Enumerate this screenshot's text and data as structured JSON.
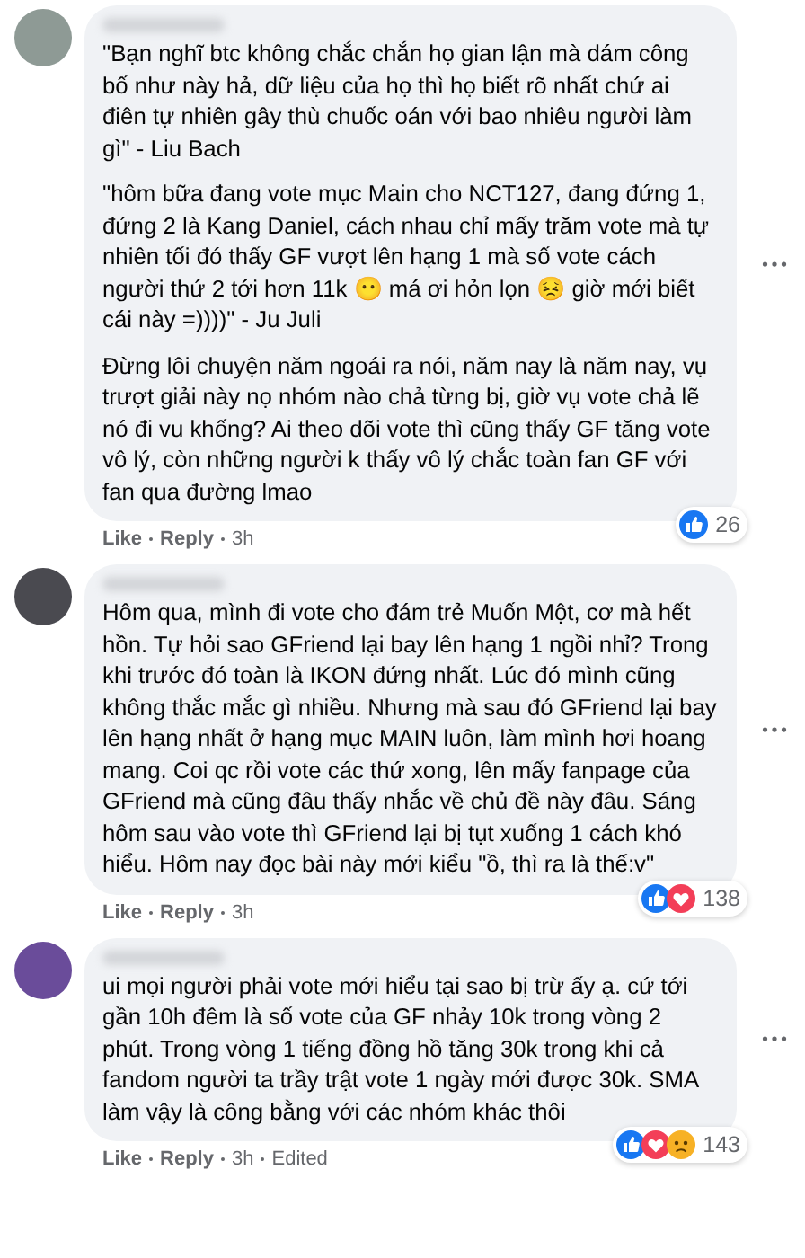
{
  "comments": [
    {
      "paragraphs": [
        "\"Bạn nghĩ btc không chắc chắn họ gian lận mà dám công bố như này hả, dữ liệu của họ thì họ biết rõ nhất chứ ai điên tự nhiên gây thù chuốc oán với bao nhiêu người làm gì\" - Liu Bach",
        "\"hôm bữa đang vote mục Main cho NCT127, đang đứng 1, đứng 2 là Kang Daniel, cách nhau chỉ mấy trăm vote mà tự nhiên tối đó thấy GF vượt lên hạng 1 mà số vote cách người thứ 2 tới hơn 11k 😶 má ơi hỏn lọn 😣 giờ mới biết cái này =))))\" - Ju Juli",
        "Đừng lôi chuyện năm ngoái ra nói, năm nay là năm nay, vụ trượt giải này nọ nhóm nào chả từng bị, giờ vụ vote chả lẽ nó đi vu khống? Ai theo dõi vote thì cũng thấy GF tăng vote vô lý, còn những người k thấy vô lý chắc toàn fan GF với fan qua đường lmao"
      ],
      "actions": [
        "Like",
        "Reply"
      ],
      "meta": [
        "3h"
      ],
      "reactions": [
        {
          "kind": "like"
        }
      ],
      "reaction_count": "26"
    },
    {
      "paragraphs": [
        "Hôm qua, mình đi vote cho đám trẻ Muốn Một, cơ mà hết hồn. Tự hỏi sao GFriend lại bay lên hạng 1 ngồi nhỉ? Trong khi trước đó toàn là IKON đứng nhất. Lúc đó mình cũng không thắc mắc gì nhiều. Nhưng mà sau đó GFriend lại bay lên hạng nhất ở hạng mục MAIN luôn, làm mình hơi hoang mang. Coi qc rồi vote các thứ xong, lên mấy fanpage của GFriend mà cũng đâu thấy nhắc về chủ đề này đâu. Sáng hôm sau vào vote thì GFriend lại bị tụt xuống 1 cách khó hiểu. Hôm nay đọc bài này mới kiểu \"ồ, thì ra là thế:v\""
      ],
      "actions": [
        "Like",
        "Reply"
      ],
      "meta": [
        "3h"
      ],
      "reactions": [
        {
          "kind": "like"
        },
        {
          "kind": "love"
        }
      ],
      "reaction_count": "138"
    },
    {
      "paragraphs": [
        "ui mọi người phải vote mới hiểu tại sao bị trừ ấy ạ. cứ tới gần 10h đêm là số vote của GF nhảy 10k trong vòng 2 phút. Trong vòng 1 tiếng đồng hồ tăng 30k trong khi cả fandom người ta trầy trật vote 1 ngày mới được 30k. SMA làm vậy là công bằng với các nhóm khác thôi"
      ],
      "actions": [
        "Like",
        "Reply"
      ],
      "meta": [
        "3h",
        "Edited"
      ],
      "reactions": [
        {
          "kind": "like"
        },
        {
          "kind": "love"
        },
        {
          "kind": "sad"
        }
      ],
      "reaction_count": "143"
    }
  ]
}
